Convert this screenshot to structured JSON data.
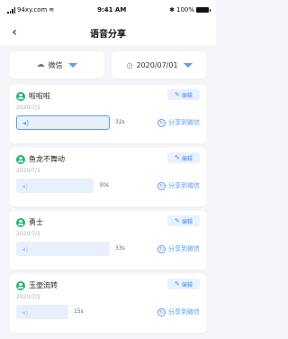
{
  "status_bar": {
    "carrier": "94xy.com",
    "time": "9:41 AM",
    "battery": "100%"
  },
  "nav": {
    "back_icon": "chevron-left-icon",
    "title": "语音分享"
  },
  "filters": {
    "channel_label": "微信",
    "date_label": "2020/07/01"
  },
  "cards": [
    {
      "name": "啦啦啦",
      "date": "2020/7/1",
      "duration": "32s",
      "edit_label": "编辑",
      "share_label": "分享到微信"
    },
    {
      "name": "鱼龙不舞动",
      "date": "2020/7/1",
      "duration": "30s",
      "edit_label": "编辑",
      "share_label": "分享到微信"
    },
    {
      "name": "勇士",
      "date": "2020/7/1",
      "duration": "33s",
      "edit_label": "编辑",
      "share_label": "分享到微信"
    },
    {
      "name": "玉壶流转",
      "date": "2020/7/1",
      "duration": "15s",
      "edit_label": "编辑",
      "share_label": "分享到微信"
    }
  ],
  "colors": {
    "accent": "#5b9bf0",
    "avatar": "#21b66f",
    "background": "#f3f5f8"
  }
}
